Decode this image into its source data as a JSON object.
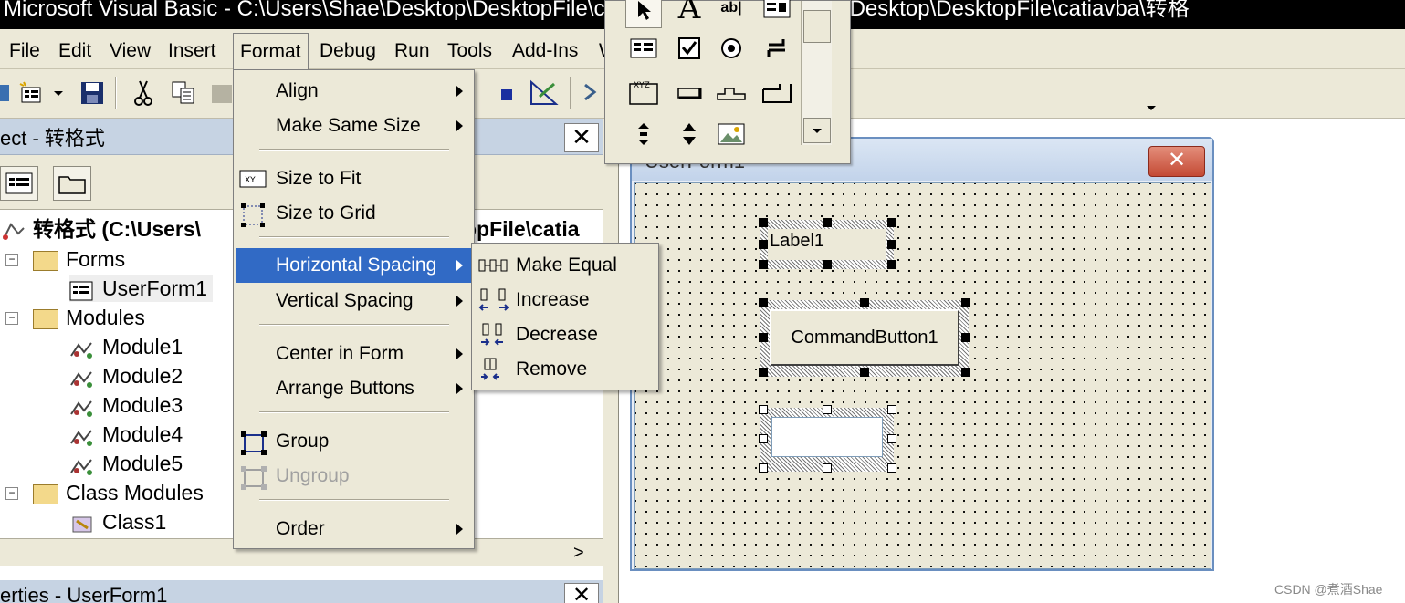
{
  "window": {
    "title": "Microsoft Visual Basic - C:\\Users\\Shae\\Desktop\\DesktopFile\\catiavba - [C:\\Users\\Shae\\Desktop\\DesktopFile\\catiavba\\转格"
  },
  "menubar": {
    "items": [
      "File",
      "Edit",
      "View",
      "Insert",
      "Format",
      "Debug",
      "Run",
      "Tools",
      "Add-Ins",
      "W"
    ]
  },
  "project": {
    "title": "ect - 转格式",
    "close_label": "✕",
    "root": "转格式 (C:\\Users\\",
    "root_tail": "opFile\\catia",
    "tree": [
      {
        "label": "Forms",
        "kind": "folder"
      },
      {
        "label": "UserForm1",
        "kind": "form"
      },
      {
        "label": "Modules",
        "kind": "folder"
      },
      {
        "label": "Module1",
        "kind": "module"
      },
      {
        "label": "Module2",
        "kind": "module"
      },
      {
        "label": "Module3",
        "kind": "module"
      },
      {
        "label": "Module4",
        "kind": "module"
      },
      {
        "label": "Module5",
        "kind": "module"
      },
      {
        "label": "Class Modules",
        "kind": "folder"
      },
      {
        "label": "Class1",
        "kind": "class"
      }
    ],
    "expander_minus": "−",
    "scroll_right": ">"
  },
  "properties": {
    "title": "erties - UserForm1",
    "close_label": "✕"
  },
  "format_menu": {
    "items": [
      {
        "label": "Align",
        "submenu": true
      },
      {
        "label": "Make Same Size",
        "submenu": true
      },
      {
        "label": "Size to Fit",
        "submenu": false
      },
      {
        "label": "Size to Grid",
        "submenu": false
      },
      {
        "label": "Horizontal Spacing",
        "submenu": true
      },
      {
        "label": "Vertical Spacing",
        "submenu": true
      },
      {
        "label": "Center in Form",
        "submenu": true
      },
      {
        "label": "Arrange Buttons",
        "submenu": true
      },
      {
        "label": "Group",
        "submenu": false
      },
      {
        "label": "Ungroup",
        "submenu": false
      },
      {
        "label": "Order",
        "submenu": true
      }
    ]
  },
  "hspacing_menu": {
    "items": [
      "Make Equal",
      "Increase",
      "Decrease",
      "Remove"
    ]
  },
  "userform": {
    "title": "UserForm1",
    "close_label": "✕",
    "label1": "Label1",
    "commandbutton1": "CommandButton1"
  },
  "toolbox": {
    "tools": [
      "pointer",
      "label",
      "textbox",
      "combobox",
      "listbox",
      "checkbox",
      "optionbutton",
      "togglebutton",
      "frame",
      "commandbutton",
      "tabstrip",
      "multipage",
      "scrollbar",
      "spinbutton",
      "image"
    ],
    "label_glyph": "A",
    "textbox_glyph": "ab|",
    "frame_glyph": "XYZ"
  },
  "watermark": "CSDN @煮酒Shae"
}
